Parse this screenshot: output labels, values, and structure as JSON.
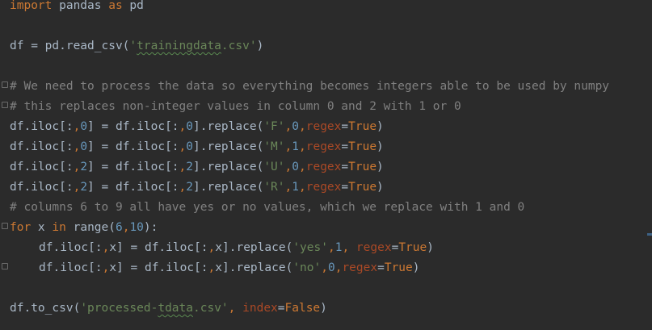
{
  "code": {
    "l1": {
      "import": "import",
      "mod": " pandas ",
      "as": "as",
      "alias": " pd"
    },
    "l2": {
      "pre": "df = pd.read_csv(",
      "q1": "'",
      "file": "trainingdata",
      "ext": ".csv'",
      "post": ")"
    },
    "l3": {
      "text": "# We need to process the data so everything becomes integers able to be used by numpy"
    },
    "l4": {
      "text": "# this replaces non-integer values in column 0 and 2 with 1 or 0"
    },
    "l5": {
      "a": "df.iloc[:",
      "c1": ",",
      "n1": "0",
      "b": "] = df.iloc[:",
      "c2": ",",
      "n2": "0",
      "d": "].replace(",
      "s": "'F'",
      "c3": ",",
      "n3": "0",
      "c4": ",",
      "kw": "regex",
      "eq": "=",
      "val": "True",
      "end": ")"
    },
    "l6": {
      "a": "df.iloc[:",
      "c1": ",",
      "n1": "0",
      "b": "] = df.iloc[:",
      "c2": ",",
      "n2": "0",
      "d": "].replace(",
      "s": "'M'",
      "c3": ",",
      "n3": "1",
      "c4": ",",
      "kw": "regex",
      "eq": "=",
      "val": "True",
      "end": ")"
    },
    "l7": {
      "a": "df.iloc[:",
      "c1": ",",
      "n1": "2",
      "b": "] = df.iloc[:",
      "c2": ",",
      "n2": "2",
      "d": "].replace(",
      "s": "'U'",
      "c3": ",",
      "n3": "0",
      "c4": ",",
      "kw": "regex",
      "eq": "=",
      "val": "True",
      "end": ")"
    },
    "l8": {
      "a": "df.iloc[:",
      "c1": ",",
      "n1": "2",
      "b": "] = df.iloc[:",
      "c2": ",",
      "n2": "2",
      "d": "].replace(",
      "s": "'R'",
      "c3": ",",
      "n3": "1",
      "c4": ",",
      "kw": "regex",
      "eq": "=",
      "val": "True",
      "end": ")"
    },
    "l9": {
      "text": "# columns 6 to 9 all have yes or no values, which we replace with 1 and 0"
    },
    "l10": {
      "for": "for",
      "x": " x ",
      "in": "in",
      "range": " range(",
      "n1": "6",
      "c": ",",
      "n2": "10",
      "end": "):"
    },
    "l11": {
      "a": "df.iloc[:",
      "c1": ",",
      "x1": "x",
      "b": "] = df.iloc[:",
      "c2": ",",
      "x2": "x",
      "d": "].replace(",
      "s": "'yes'",
      "c3": ",",
      "n": "1",
      "c4": ", ",
      "kw": "regex",
      "eq": "=",
      "val": "True",
      "end": ")"
    },
    "l12": {
      "a": "df.iloc[:",
      "c1": ",",
      "x1": "x",
      "b": "] = df.iloc[:",
      "c2": ",",
      "x2": "x",
      "d": "].replace(",
      "s": "'no'",
      "c3": ",",
      "n": "0",
      "c4": ",",
      "kw": "regex",
      "eq": "=",
      "val": "True",
      "end": ")"
    },
    "l13": {
      "pre": "df.to_csv(",
      "s1": "'processed-",
      "typo": "tdata",
      "s2": ".csv'",
      "c": ", ",
      "kw": "index",
      "eq": "=",
      "val": "False",
      "end": ")"
    }
  },
  "colors": {
    "background": "#2b2b2b",
    "keyword": "#cc7832",
    "string": "#6a8759",
    "comment": "#808080",
    "number": "#6897bb",
    "kwarg": "#aa4926",
    "text": "#a9b7c6"
  }
}
